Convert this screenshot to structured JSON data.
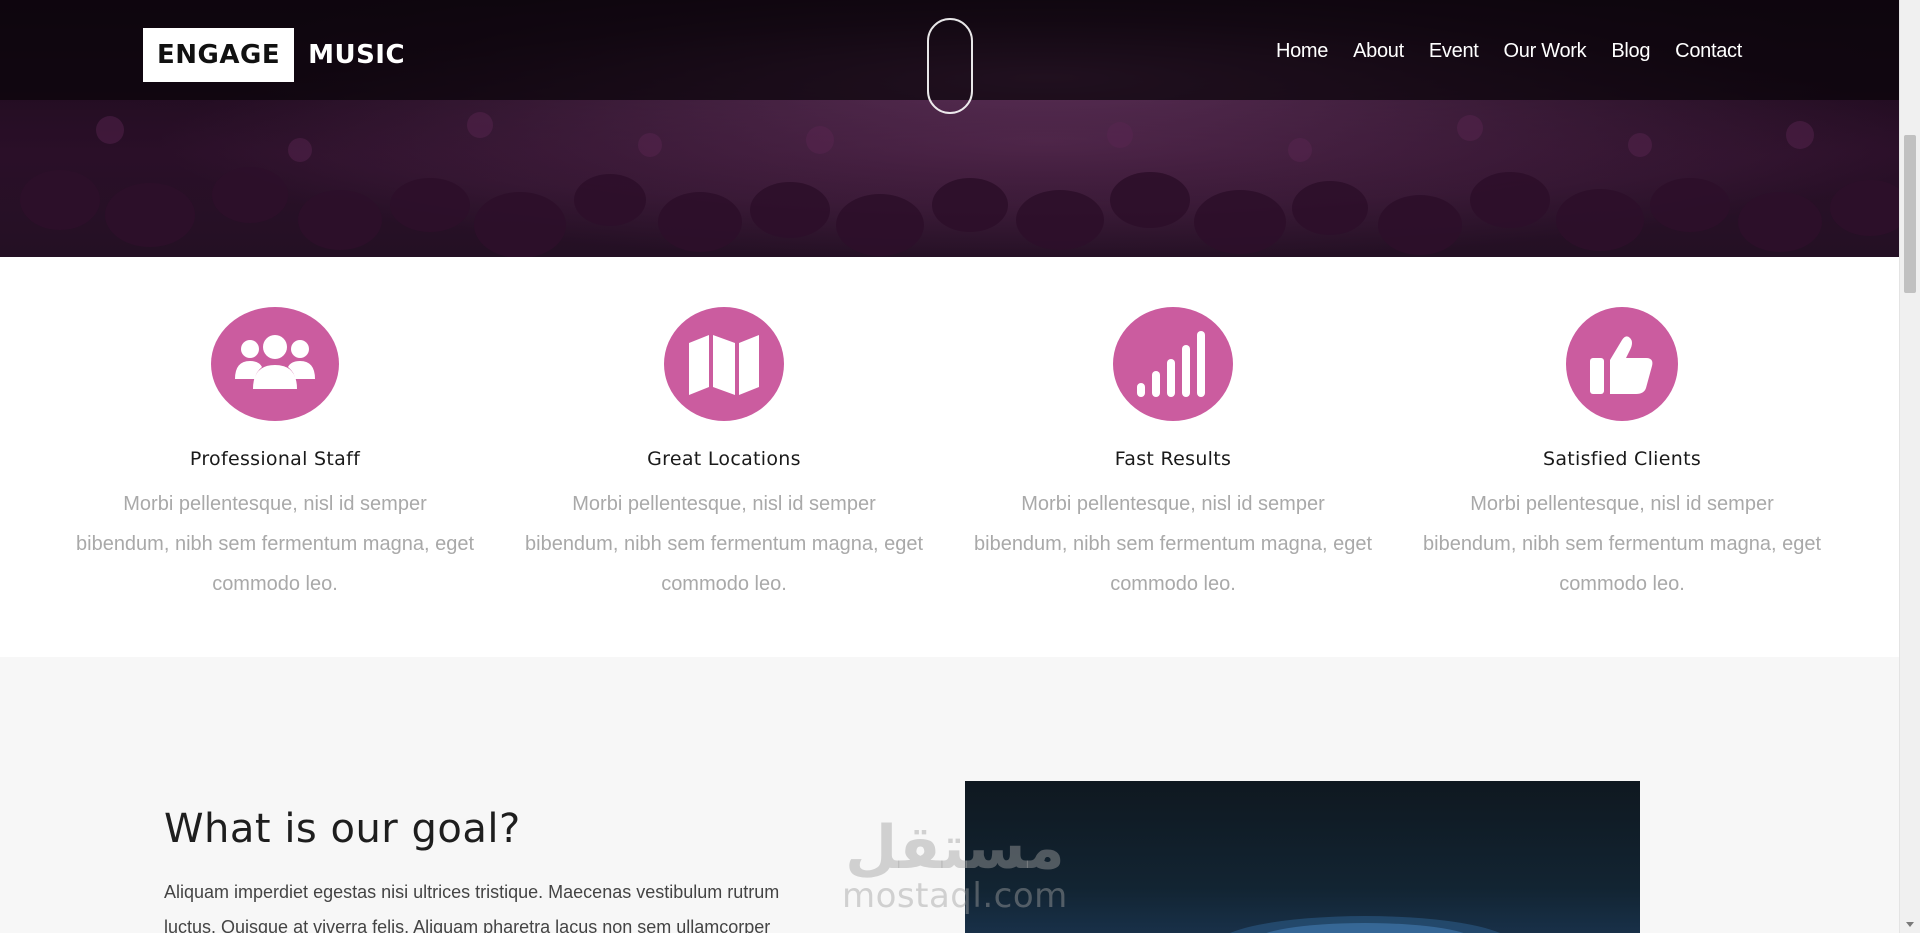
{
  "brand": {
    "part1": "ENGAGE",
    "part2": "MUSIC"
  },
  "nav": {
    "items": [
      {
        "label": "Home"
      },
      {
        "label": "About"
      },
      {
        "label": "Event"
      },
      {
        "label": "Our Work"
      },
      {
        "label": "Blog"
      },
      {
        "label": "Contact"
      }
    ]
  },
  "colors": {
    "accent": "#cb5c9f",
    "hero_overlay": "#1a0a1a",
    "goal_bg": "#f7f7f7"
  },
  "features": [
    {
      "icon": "users-icon",
      "title": "Professional Staff",
      "text": "Morbi pellentesque, nisl id semper bibendum, nibh sem fermentum magna, eget commodo leo."
    },
    {
      "icon": "map-icon",
      "title": "Great Locations",
      "text": "Morbi pellentesque, nisl id semper bibendum, nibh sem fermentum magna, eget commodo leo."
    },
    {
      "icon": "signal-bars-icon",
      "title": "Fast Results",
      "text": "Morbi pellentesque, nisl id semper bibendum, nibh sem fermentum magna, eget commodo leo."
    },
    {
      "icon": "thumbs-up-icon",
      "title": "Satisfied Clients",
      "text": "Morbi pellentesque, nisl id semper bibendum, nibh sem fermentum magna, eget commodo leo."
    }
  ],
  "goal": {
    "title": "What is our goal?",
    "text": "Aliquam imperdiet egestas nisi ultrices tristique. Maecenas vestibulum rutrum luctus. Quisque at viverra felis. Aliquam pharetra lacus non sem ullamcorper"
  },
  "watermark": {
    "arabic": "مستقل",
    "latin": "mostaql.com"
  }
}
